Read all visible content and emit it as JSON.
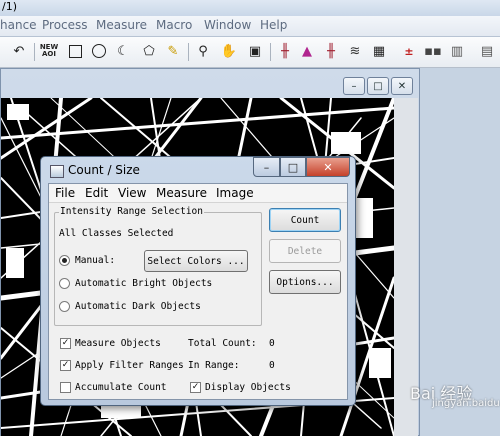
{
  "app": {
    "title_fragment": "/1)",
    "menu": [
      "hance",
      "Process",
      "Measure",
      "Macro",
      "Window",
      "Help"
    ]
  },
  "toolbar": {
    "icons": [
      "undo-icon",
      "new-aoi-icon",
      "rectangle-icon",
      "ellipse-icon",
      "irregular-icon",
      "polygon-icon",
      "wand-icon",
      "zoom-icon",
      "hand-icon",
      "select-icon",
      "threshold-icon",
      "histogram-icon",
      "count-icon",
      "layers-icon",
      "grid-icon",
      "calc-icon",
      "palette-icon",
      "panels-icon"
    ],
    "new_aoi_label": "NEW\nAOI"
  },
  "image_window": {
    "controls": [
      "–",
      "□",
      "✕"
    ]
  },
  "dialog": {
    "title": "Count / Size",
    "controls": [
      "–",
      "□",
      "✕"
    ],
    "menu": [
      "File",
      "Edit",
      "View",
      "Measure",
      "Image"
    ],
    "group_label": "Intensity Range Selection",
    "all_classes": "All Classes Selected",
    "manual_label": "Manual:",
    "select_colors_label": "Select Colors ...",
    "auto_bright_label": "Automatic Bright Objects",
    "auto_dark_label": "Automatic Dark Objects",
    "count_button": "Count",
    "delete_button": "Delete",
    "options_button": "Options...",
    "measure_objects": "Measure Objects",
    "apply_filter": "Apply Filter Ranges",
    "accumulate": "Accumulate Count",
    "display_objects": "Display Objects",
    "total_count_label": "Total Count:",
    "total_count_value": "0",
    "in_range_label": "In Range:",
    "in_range_value": "0",
    "checked": {
      "manual": true,
      "measure_objects": true,
      "apply_filter": true,
      "accumulate": false,
      "display_objects": true
    }
  },
  "watermark": {
    "text": "Bai 经验",
    "sub": "jingyan.baidu.com"
  }
}
